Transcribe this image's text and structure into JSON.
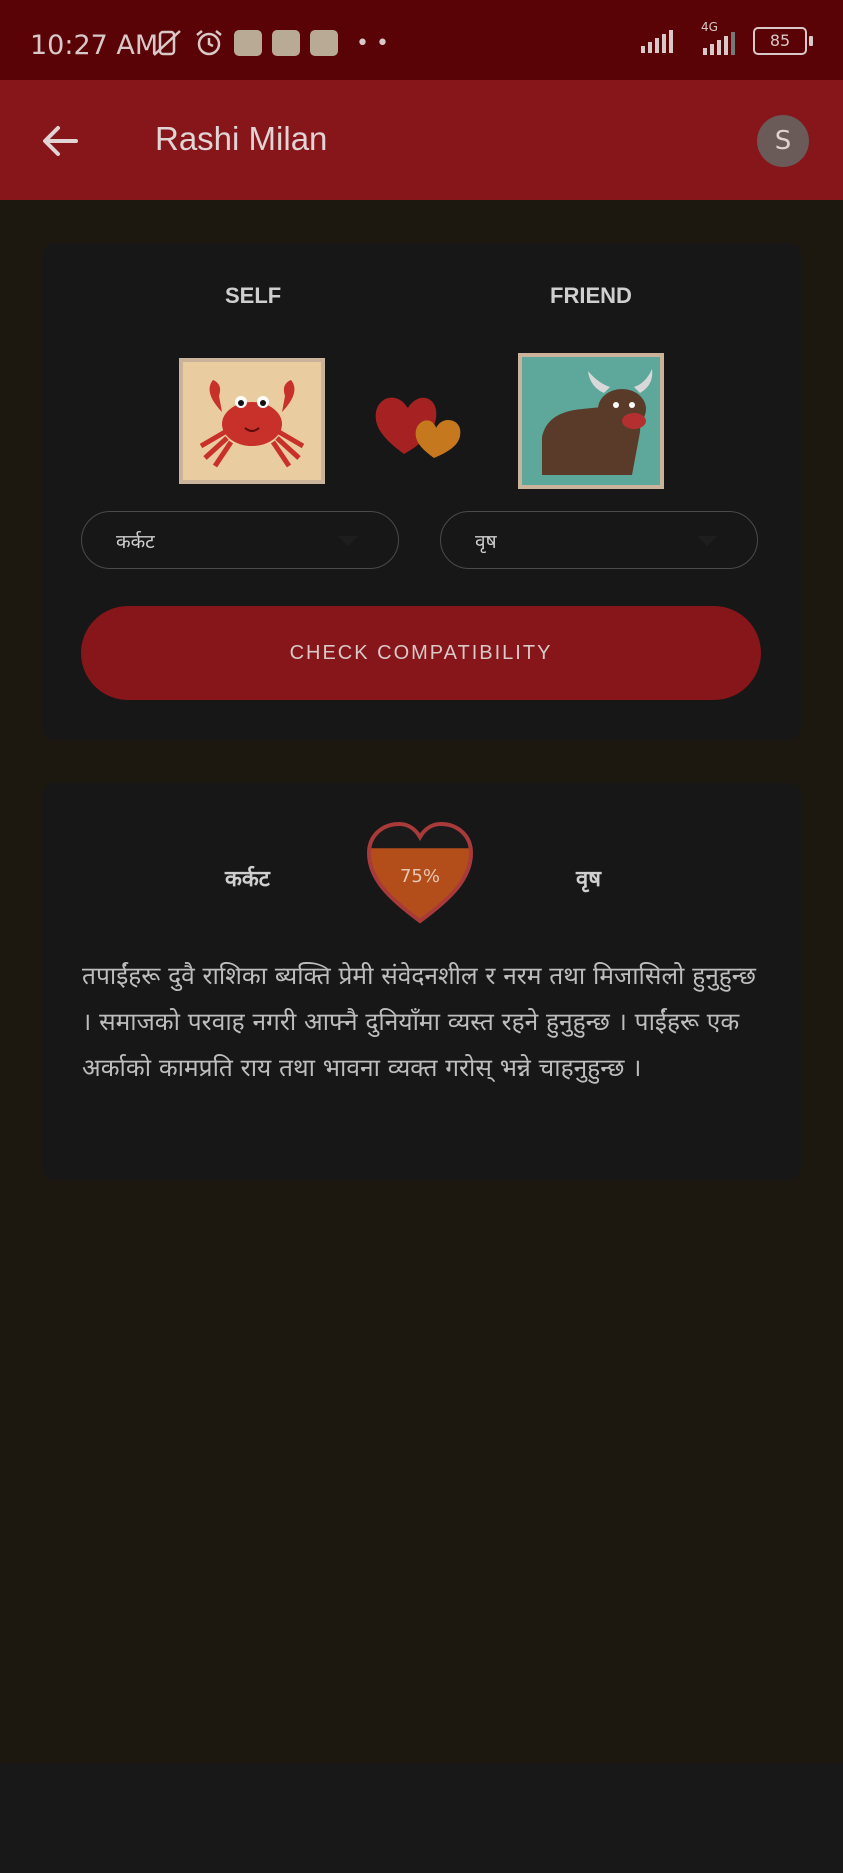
{
  "status_bar": {
    "time": "10:27 AM",
    "network": "4G",
    "battery": "85"
  },
  "app_bar": {
    "title": "Rashi Milan",
    "avatar_letter": "S"
  },
  "selection": {
    "self_label": "SELF",
    "friend_label": "FRIEND",
    "self_sign_icon": "crab-icon",
    "friend_sign_icon": "bull-icon",
    "self_value": "कर्कट",
    "friend_value": "वृष",
    "check_button": "CHECK COMPATIBILITY"
  },
  "result": {
    "self_sign": "कर्कट",
    "friend_sign": "वृष",
    "percent_text": "75%",
    "percent_value": 75,
    "description": "तपाईंहरू दुवै राशिका ब्यक्ति प्रेमी संवेदनशील र नरम तथा मिजासिलो हुनुहुन्छ । समाजको परवाह नगरी आफ्नै दुनियाँमा व्यस्त रहने हुनुहुन्छ ।  पाईंहरू एक अर्काको कामप्रति राय तथा भावना व्यक्त गरोस् भन्ने चाहनुहुन्छ ।"
  },
  "colors": {
    "primary": "#86161a",
    "status": "#5a0306",
    "background": "#1c1810",
    "card": "#171717",
    "meter_fill": "#b34e1a"
  }
}
